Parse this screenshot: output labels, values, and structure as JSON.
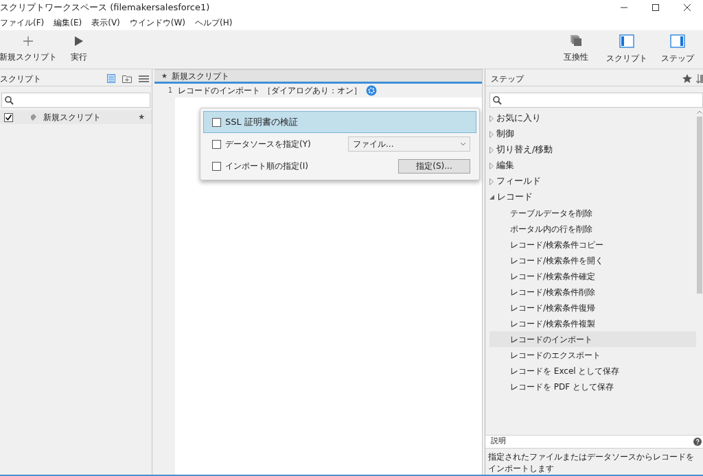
{
  "window": {
    "title": "スクリプトワークスペース (filemakersalesforce1)"
  },
  "menu": [
    "ファイル(F)",
    "編集(E)",
    "表示(V)",
    "ウインドウ(W)",
    "ヘルプ(H)"
  ],
  "toolbar_left": [
    {
      "kind": "plus",
      "label": "新規スクリプト"
    },
    {
      "kind": "play",
      "label": "実行"
    }
  ],
  "toolbar_right": [
    {
      "kind": "compat",
      "label": "互換性"
    },
    {
      "kind": "left",
      "label": "スクリプト"
    },
    {
      "kind": "right",
      "label": "ステップ"
    }
  ],
  "scripts_panel": {
    "title": "スクリプト",
    "items": [
      {
        "name": "新規スクリプト",
        "checked": true,
        "mark": "★"
      }
    ]
  },
  "editor": {
    "tab": {
      "mark": "★",
      "title": "新規スクリプト"
    },
    "lines": [
      {
        "number": "1",
        "text": "レコードのインポート ［ダイアログあり：オン］"
      }
    ],
    "popover": {
      "options": [
        {
          "kind": "check",
          "label": "SSL 証明書の検証",
          "checked": false,
          "selected": true
        },
        {
          "kind": "dropdown",
          "label": "データソースを指定(Y)",
          "checked": false,
          "selected": false,
          "value": "ファイル..."
        },
        {
          "kind": "button",
          "label": "インポート順の指定(I)",
          "checked": false,
          "selected": false,
          "button": "指定(S)..."
        }
      ]
    }
  },
  "steps_panel": {
    "title": "ステップ",
    "categories": [
      {
        "label": "お気に入り",
        "expanded": false
      },
      {
        "label": "制御",
        "expanded": false
      },
      {
        "label": "切り替え/移動",
        "expanded": false
      },
      {
        "label": "編集",
        "expanded": false
      },
      {
        "label": "フィールド",
        "expanded": false
      },
      {
        "label": "レコード",
        "expanded": true,
        "children": [
          {
            "label": "テーブルデータを削除",
            "selected": false
          },
          {
            "label": "ポータル内の行を削除",
            "selected": false
          },
          {
            "label": "レコード/検索条件コピー",
            "selected": false
          },
          {
            "label": "レコード/検索条件を開く",
            "selected": false
          },
          {
            "label": "レコード/検索条件確定",
            "selected": false
          },
          {
            "label": "レコード/検索条件削除",
            "selected": false
          },
          {
            "label": "レコード/検索条件復帰",
            "selected": false
          },
          {
            "label": "レコード/検索条件複製",
            "selected": false
          },
          {
            "label": "レコードのインポート",
            "selected": true
          },
          {
            "label": "レコードのエクスポート",
            "selected": false
          },
          {
            "label": "レコードを Excel として保存",
            "selected": false
          },
          {
            "label": "レコードを PDF として保存",
            "selected": false
          }
        ]
      }
    ]
  },
  "description": {
    "title": "説明",
    "text": "指定されたファイルまたはデータソースからレコードをインポートします"
  }
}
